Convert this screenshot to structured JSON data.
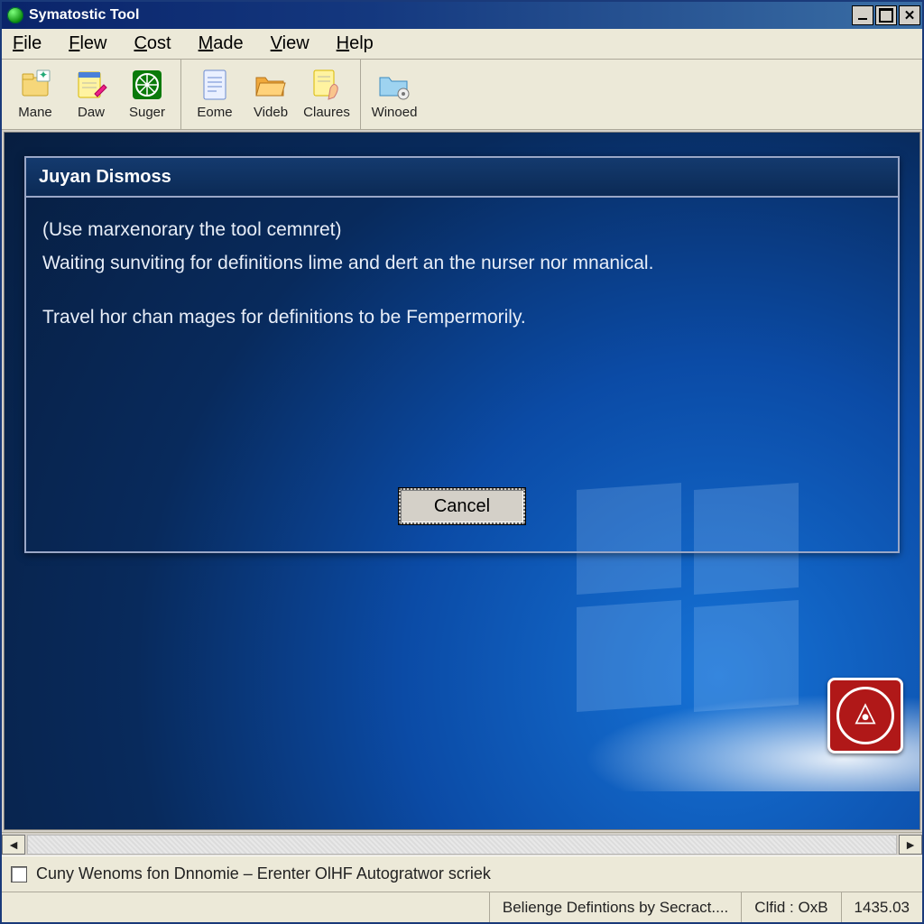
{
  "titlebar": {
    "title": "Symatostic Tool"
  },
  "menu": {
    "items": [
      {
        "label": "File",
        "accel": "F"
      },
      {
        "label": "Flew",
        "accel": "F"
      },
      {
        "label": "Cost",
        "accel": "C"
      },
      {
        "label": "Made",
        "accel": "M"
      },
      {
        "label": "View",
        "accel": "V"
      },
      {
        "label": "Help",
        "accel": "H"
      }
    ]
  },
  "toolbar": {
    "groups": [
      [
        {
          "id": "mane",
          "label": "Mane",
          "icon": "folder-new-icon"
        },
        {
          "id": "daw",
          "label": "Daw",
          "icon": "note-pencil-icon"
        },
        {
          "id": "suger",
          "label": "Suger",
          "icon": "globe-green-icon"
        }
      ],
      [
        {
          "id": "eome",
          "label": "Eome",
          "icon": "document-lines-icon"
        },
        {
          "id": "videb",
          "label": "Videb",
          "icon": "folder-open-icon"
        },
        {
          "id": "claures",
          "label": "Claures",
          "icon": "note-hand-icon"
        }
      ],
      [
        {
          "id": "winoed",
          "label": "Winoed",
          "icon": "folder-gear-icon"
        }
      ]
    ]
  },
  "dialog": {
    "title": "Juyan Dismoss",
    "line1": "(Use marxenorary the tool cemnret)",
    "line2": "Waiting sunviting for definitions lime and dert an the nurser nor mnanical.",
    "line3": "Travel hor chan mages for definitions to be Fempermorily.",
    "cancel_label": "Cancel"
  },
  "checkrow": {
    "checked": false,
    "label": "Cuny Wenoms fon Dnnomie – Erenter OlHF Autogratwor scriek"
  },
  "statusbar": {
    "cell1": "Belienge Defintions by Secract....",
    "cell2": "Clfid   : OxB",
    "cell3": "1435.03"
  },
  "colors": {
    "titlebar_start": "#0a246a",
    "titlebar_end": "#3a6ea5",
    "chrome_bg": "#ece9d8",
    "desktop_accent": "#0b4ba6",
    "badge_bg": "#b01818"
  }
}
